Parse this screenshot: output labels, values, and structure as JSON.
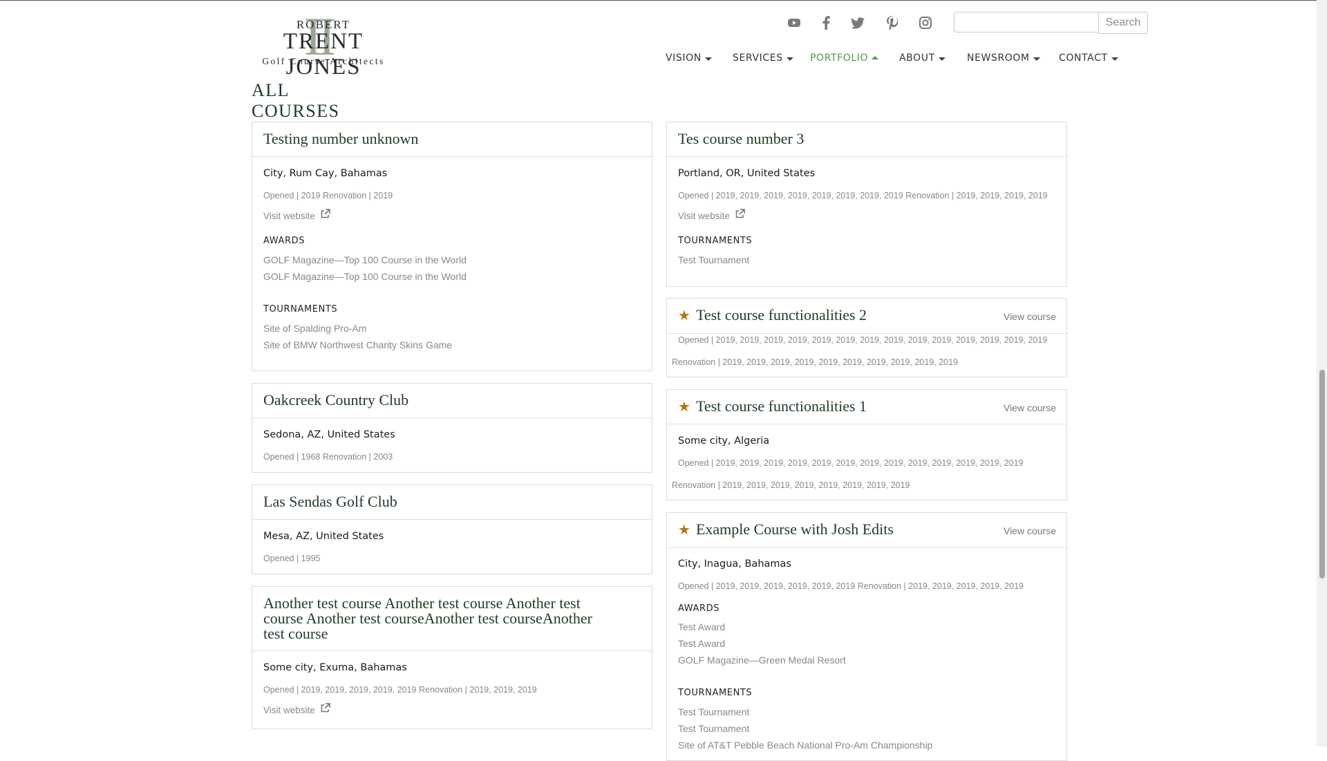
{
  "logo": {
    "line1": "ROBERT",
    "line2": "TRENT JONES",
    "line3": "Golf Course Architects",
    "numeral": "II"
  },
  "social": [
    {
      "icon": "youtube-icon"
    },
    {
      "icon": "facebook-icon"
    },
    {
      "icon": "twitter-icon"
    },
    {
      "icon": "pinterest-icon"
    },
    {
      "icon": "instagram-icon"
    }
  ],
  "search": {
    "value": "",
    "button_label": "Search"
  },
  "nav": {
    "items": [
      {
        "label": "VISION",
        "active": false
      },
      {
        "label": "SERVICES",
        "active": false
      },
      {
        "label": "PORTFOLIO",
        "active": true
      },
      {
        "label": "ABOUT",
        "active": false
      },
      {
        "label": "NEWSROOM",
        "active": false
      },
      {
        "label": "CONTACT",
        "active": false
      }
    ]
  },
  "colors": {
    "accent_green": "#4a9a4a",
    "title_green": "#1f3b24",
    "star": "#b9720c"
  },
  "page": {
    "heading": "ALL COURSES"
  },
  "view_course_label": "View course",
  "visit_label": "Visit website",
  "section_labels": {
    "awards": "AWARDS",
    "tournaments": "TOURNAMENTS"
  },
  "courses": [
    {
      "title": "Testing number unknown",
      "location": "City, Rum Cay, Bahamas",
      "dates": "Opened | 2019  Renovation | 2019",
      "awards": [
        "GOLF Magazine—Top 100 Course in the World",
        "GOLF Magazine—Top 100 Course in the World"
      ],
      "tournaments": [
        "Site of Spalding Pro-Am",
        "Site of BMW Northwest Charity Skins Game"
      ]
    },
    {
      "title": "Oakcreek Country Club",
      "location": "Sedona, AZ, United States",
      "dates": "Opened | 1968  Renovation | 2003"
    },
    {
      "title": "Las Sendas Golf Club",
      "location": "Mesa, AZ, United States",
      "dates": "Opened | 1995"
    },
    {
      "title_lines": [
        "Another test course Another test course Another test",
        "course Another test courseAnother test courseAnother",
        "test course"
      ],
      "location": "Some city, Exuma, Bahamas",
      "dates": "Opened | 2019, 2019, 2019, 2019, 2019  Renovation | 2019, 2019, 2019"
    },
    {
      "title": "Tes course number 3",
      "location": "Portland, OR, United States",
      "dates": "Opened | 2019, 2019, 2019, 2019, 2019, 2019, 2019, 2019  Renovation | 2019, 2019, 2019, 2019",
      "tournaments": [
        "Test Tournament"
      ]
    },
    {
      "title": "Test course functionalities 2",
      "featured": true,
      "dates_opened": "Opened | 2019, 2019, 2019, 2019, 2019, 2019, 2019, 2019, 2019, 2019, 2019, 2019, 2019, 2019",
      "dates_renovation": "Renovation | 2019, 2019, 2019, 2019, 2019, 2019, 2019, 2019, 2019, 2019"
    },
    {
      "title": "Test course functionalities 1",
      "featured": true,
      "location": "Some city, Algeria",
      "dates_opened": "Opened | 2019, 2019, 2019, 2019, 2019, 2019, 2019, 2019, 2019, 2019, 2019, 2019, 2019",
      "dates_renovation": "Renovation | 2019, 2019, 2019, 2019, 2019, 2019, 2019, 2019"
    },
    {
      "title": "Example Course with Josh Edits",
      "featured": true,
      "location": "City, Inagua, Bahamas",
      "dates": "Opened | 2019, 2019, 2019, 2019, 2019, 2019  Renovation | 2019, 2019, 2019, 2019, 2019",
      "awards": [
        "Test Award",
        "Test Award",
        "GOLF Magazine—Green Medal Resort"
      ],
      "tournaments": [
        "Test Tournament",
        "Test Tournament",
        "Site of AT&T Pebble Beach National Pro-Am Championship"
      ]
    }
  ]
}
